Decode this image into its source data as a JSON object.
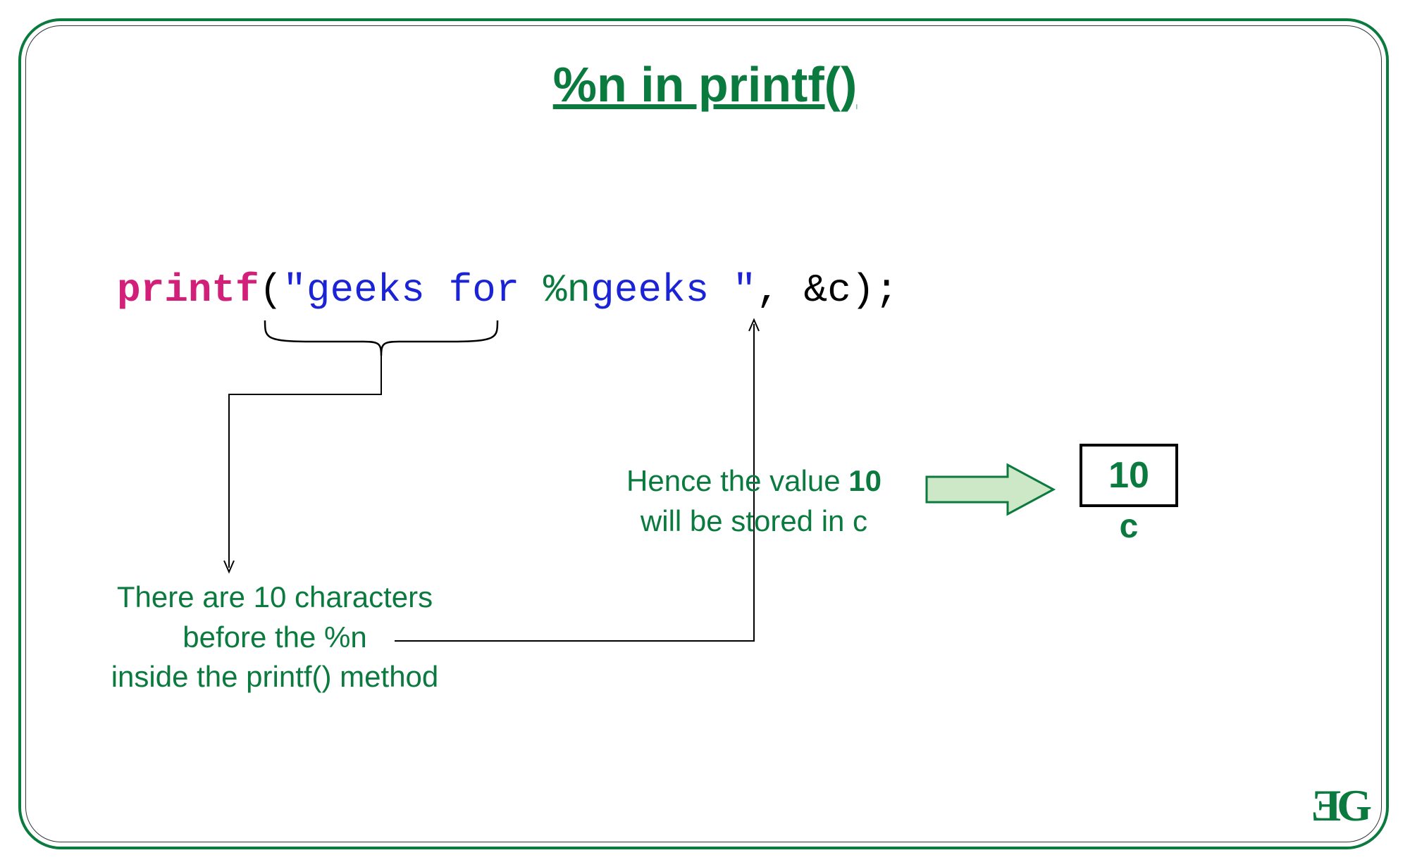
{
  "title": "%n in printf()",
  "code": {
    "kw": "printf",
    "open": "(",
    "q1": "\"",
    "s1": "geeks for ",
    "pct": "%n",
    "s2": "geeks ",
    "q2": "\"",
    "rest": ", &c);"
  },
  "callout_left_l1": "There are 10 characters",
  "callout_left_l2": "before the %n",
  "callout_left_l3": "inside the printf() method",
  "callout_right_pre": "Hence the value ",
  "callout_right_bold": "10",
  "callout_right_l2": "will be stored in c",
  "box_value": "10",
  "box_label": "c",
  "logo": "ƎG"
}
